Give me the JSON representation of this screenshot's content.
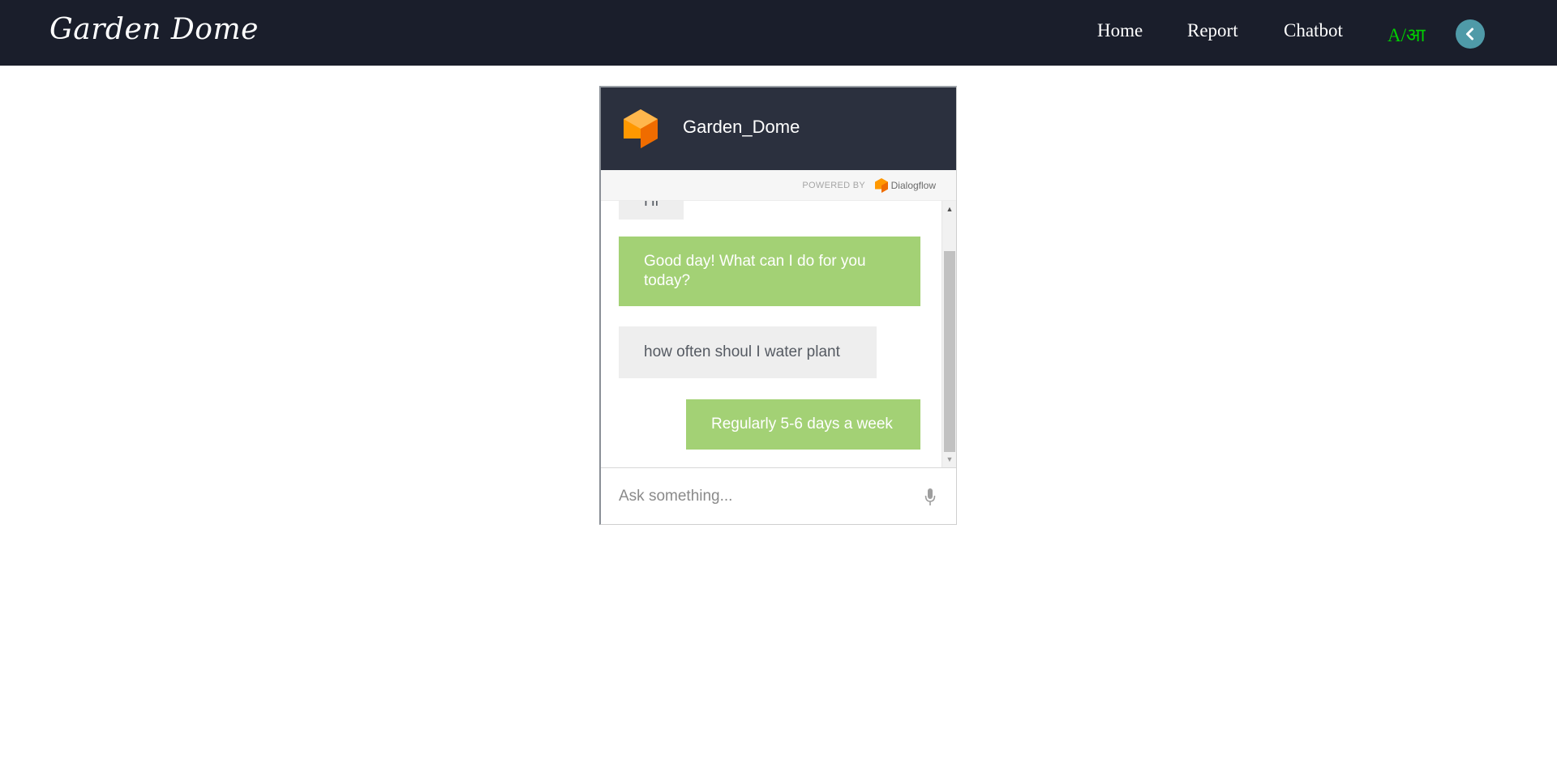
{
  "nav": {
    "brand": "Garden Dome",
    "links": [
      "Home",
      "Report",
      "Chatbot"
    ],
    "lang_latin": "A",
    "lang_sep": "/",
    "lang_devanagari": "आ",
    "back_icon": "chevron-left-icon"
  },
  "chat": {
    "agent_name": "Garden_Dome",
    "powered_by": "POWERED BY",
    "powered_brand": "Dialogflow",
    "messages": [
      {
        "from": "user",
        "text": "Hi"
      },
      {
        "from": "bot",
        "text": "Good day! What can I do for you today?"
      },
      {
        "from": "user",
        "text": "how often shoul I water plant"
      },
      {
        "from": "bot",
        "text": "Regularly 5-6 days a week"
      }
    ],
    "input_placeholder": "Ask something...",
    "mic_icon": "microphone-icon"
  },
  "colors": {
    "navbar_bg": "#1a1e2b",
    "lang_color": "#00d000",
    "back_button_bg": "#4f9aa8",
    "chat_header_bg": "#2b303e",
    "bot_bubble": "#a3d175",
    "user_bubble": "#eeeeee",
    "dialogflow_orange": "#f57c00"
  }
}
